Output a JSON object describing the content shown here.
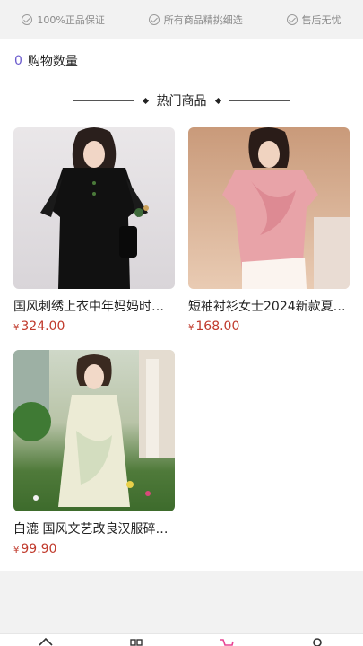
{
  "guarantees": [
    {
      "icon": "check-circle-icon",
      "label": "100%正品保证"
    },
    {
      "icon": "check-circle-icon",
      "label": "所有商品精挑细选"
    },
    {
      "icon": "check-circle-icon",
      "label": "售后无忧"
    }
  ],
  "cart": {
    "count": "0",
    "label": "购物数量"
  },
  "section": {
    "title": "热门商品"
  },
  "products": [
    {
      "name": "国风刺绣上衣中年妈妈时…",
      "currency": "¥",
      "price": "324.00"
    },
    {
      "name": "短袖衬衫女士2024新款夏…",
      "currency": "¥",
      "price": "168.00"
    },
    {
      "name": "白漉 国风文艺改良汉服碎…",
      "currency": "¥",
      "price": "99.90"
    }
  ],
  "bottom_nav": [
    {
      "icon": "home-icon"
    },
    {
      "icon": "category-icon"
    },
    {
      "icon": "cart-icon",
      "active_color": "#e84393"
    },
    {
      "icon": "user-icon"
    }
  ]
}
